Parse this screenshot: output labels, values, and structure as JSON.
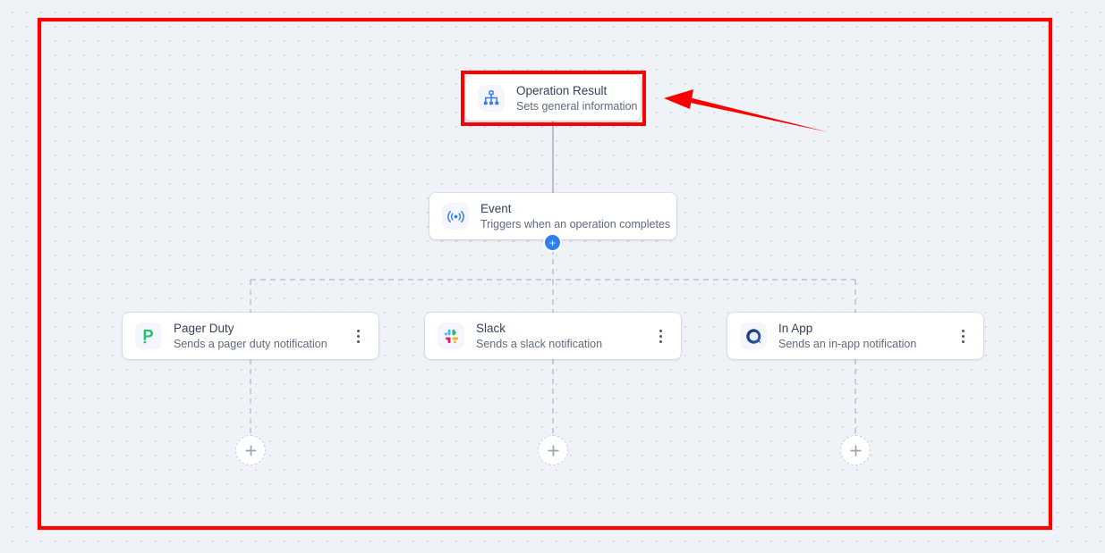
{
  "canvas": {
    "background_color": "#eff3f8",
    "dot_color": "#d4dce7"
  },
  "annotation": {
    "highlight_box_color": "#ff0000",
    "arrow_color": "#fb0000",
    "highlight_target": "Operation Result node",
    "region_box_label": "region-highlight"
  },
  "nodes": [
    {
      "id": "operation-result",
      "title": "Operation Result",
      "subtitle": "Sets general information",
      "icon": "hierarchy-icon",
      "icon_color": "#2f7cf6",
      "has_kebab": false,
      "selected": true
    },
    {
      "id": "event",
      "title": "Event",
      "subtitle": "Triggers when an operation completes",
      "icon": "broadcast-signal-icon",
      "icon_color": "#2f7cf6",
      "has_kebab": false,
      "selected": false
    },
    {
      "id": "pager-duty",
      "title": "Pager Duty",
      "subtitle": "Sends a pager duty notification",
      "icon": "pagerduty-logo-icon",
      "icon_color": "#25c16f",
      "has_kebab": true,
      "selected": false
    },
    {
      "id": "slack",
      "title": "Slack",
      "subtitle": "Sends a slack notification",
      "icon": "slack-logo-icon",
      "icon_color": "#36c5f0",
      "has_kebab": true,
      "selected": false
    },
    {
      "id": "in-app",
      "title": "In App",
      "subtitle": "Sends an in-app notification",
      "icon": "in-app-bell-logo-icon",
      "icon_color": "#1e3a8a",
      "has_kebab": true,
      "selected": false
    }
  ],
  "handles": {
    "add_step_after_event_label": "+",
    "add_step_color": "#2f80ed",
    "add_branch_labels": [
      "+",
      "+",
      "+"
    ]
  },
  "kebab_menu": {
    "label": "⋮",
    "name": "more-options"
  }
}
